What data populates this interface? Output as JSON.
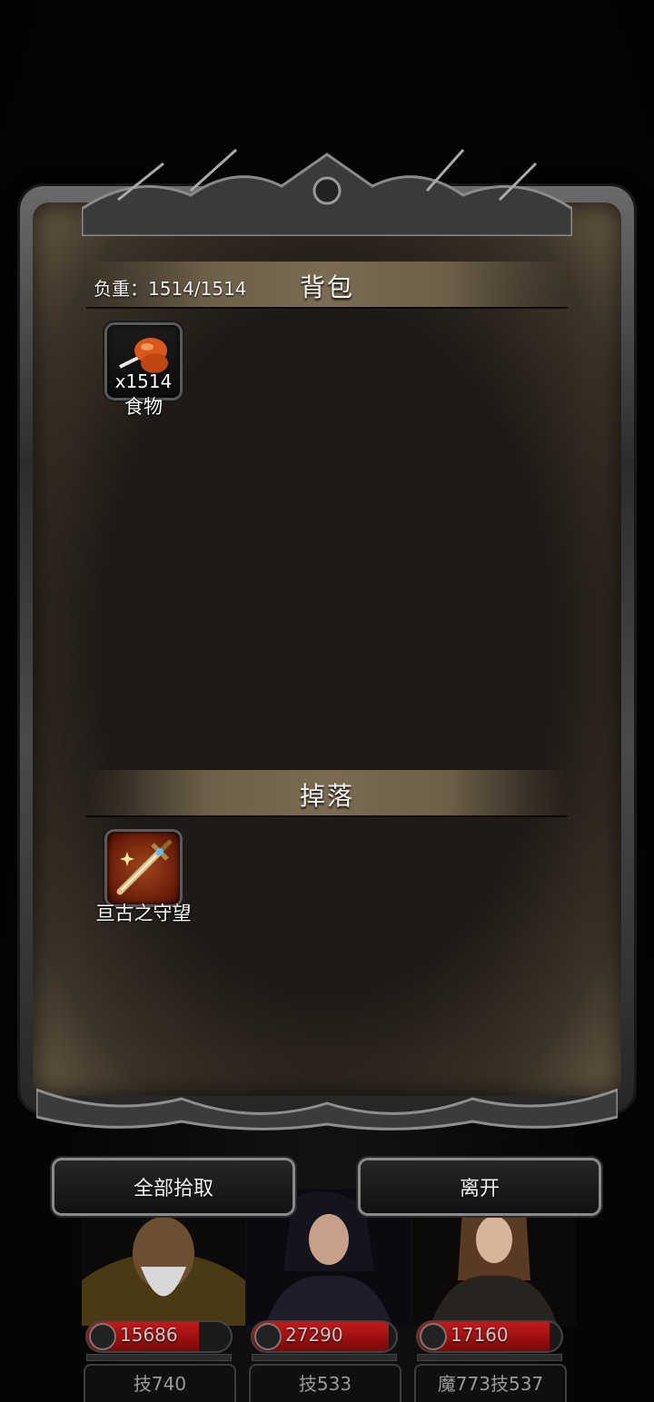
{
  "inventory": {
    "title": "背包",
    "weight_label": "负重：1514/1514",
    "items": [
      {
        "name": "食物",
        "count": "x1514",
        "icon": "drumstick-icon"
      }
    ]
  },
  "loot": {
    "title": "掉落",
    "items": [
      {
        "name": "亘古之守望",
        "icon": "sword-icon"
      }
    ]
  },
  "actions": {
    "pickup_all": "全部拾取",
    "leave": "离开"
  },
  "party": [
    {
      "hp": "15686",
      "stat": "技740",
      "hp_fraction": 0.78
    },
    {
      "hp": "27290",
      "stat": "技533",
      "hp_fraction": 0.95
    },
    {
      "hp": "17160",
      "stat": "魔773技537",
      "hp_fraction": 0.92
    }
  ],
  "colors": {
    "panel": "#1f1a16",
    "header": "#7a6b52",
    "hp": "#c21a1a"
  }
}
